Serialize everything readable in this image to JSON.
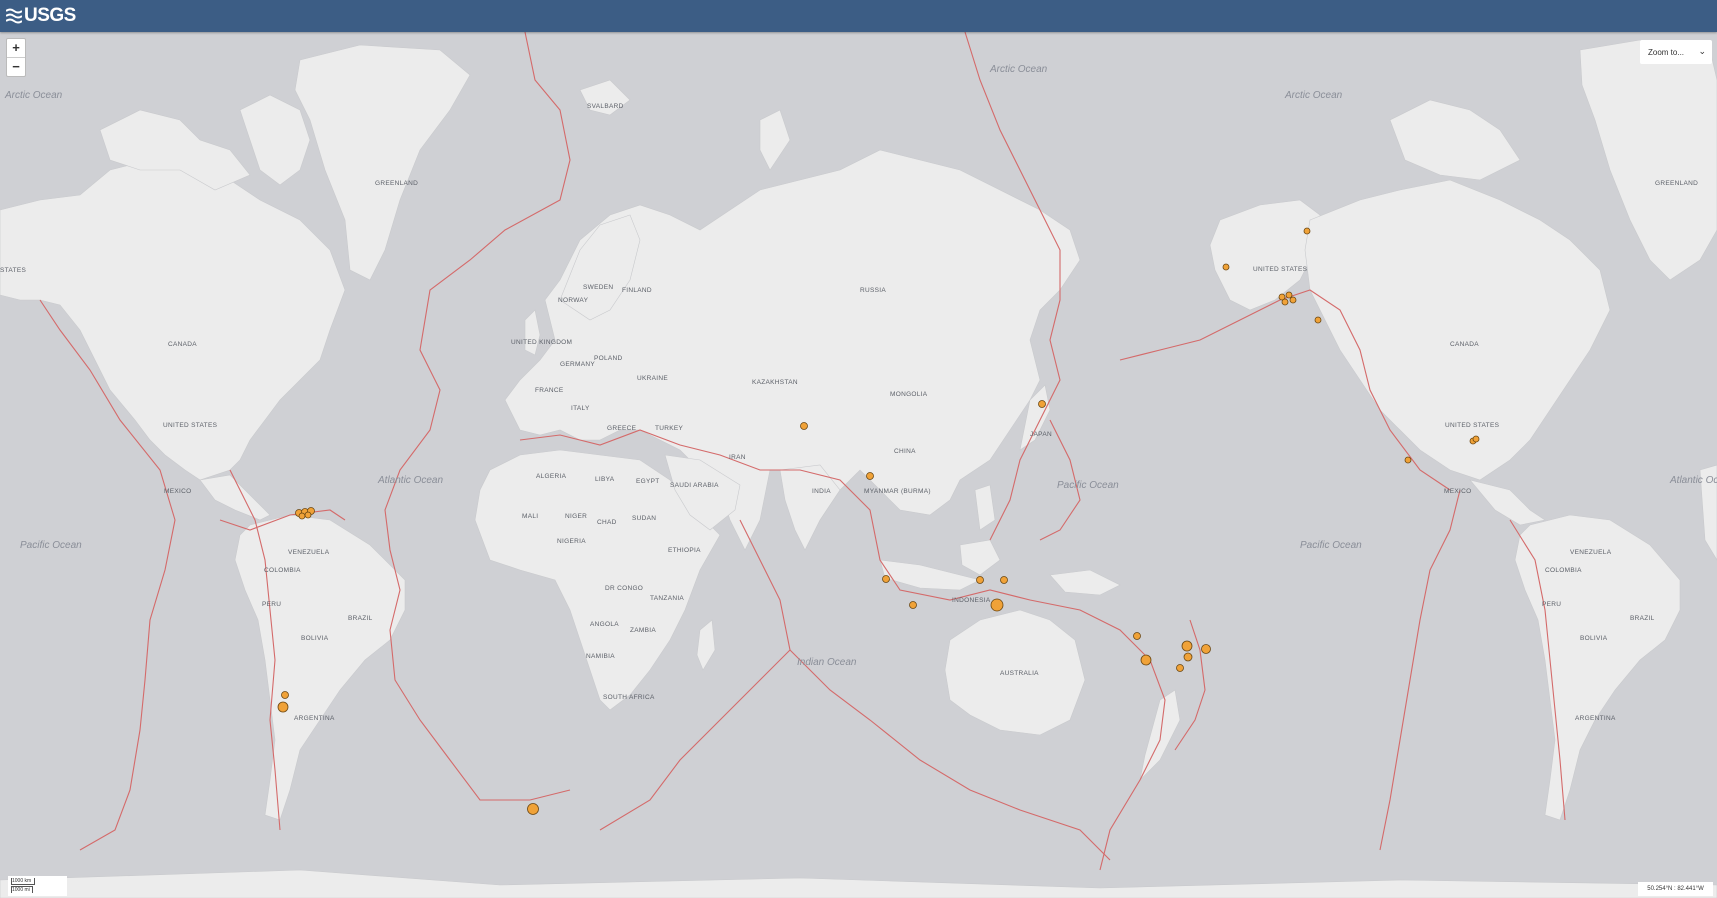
{
  "header": {
    "logo_text": "USGS"
  },
  "controls": {
    "zoom_in": "+",
    "zoom_out": "−",
    "zoom_to_label": "Zoom to..."
  },
  "scale": {
    "km": "1000 km",
    "mi": "1000 mi"
  },
  "coordinates": "50.254°N : 82.441°W",
  "colors": {
    "header": "#3c5d85",
    "water": "#cfd0d4",
    "land": "#ececec",
    "plate_boundary": "#d46a6a",
    "quake": "#f0a238"
  },
  "oceans": [
    "Arctic Ocean",
    "Arctic Ocean",
    "Arctic Ocean",
    "Atlantic Ocean",
    "Pacific Ocean",
    "Pacific Ocean",
    "Pacific Ocean",
    "Indian Ocean",
    "Atlantic Ocean"
  ],
  "countries": [
    "GREENLAND",
    "CANADA",
    "UNITED STATES",
    "MEXICO",
    "VENEZUELA",
    "COLOMBIA",
    "PERU",
    "BRAZIL",
    "BOLIVIA",
    "ARGENTINA",
    "SWEDEN",
    "FINLAND",
    "NORWAY",
    "UNITED KINGDOM",
    "GERMANY",
    "POLAND",
    "UKRAINE",
    "FRANCE",
    "ITALY",
    "GREECE",
    "TURKEY",
    "ALGERIA",
    "LIBYA",
    "EGYPT",
    "MALI",
    "NIGER",
    "CHAD",
    "SUDAN",
    "NIGERIA",
    "ETHIOPIA",
    "DR CONGO",
    "TANZANIA",
    "ANGOLA",
    "ZAMBIA",
    "NAMIBIA",
    "SOUTH AFRICA",
    "SAUDI ARABIA",
    "IRAN",
    "KAZAKHSTAN",
    "RUSSIA",
    "MONGOLIA",
    "CHINA",
    "INDIA",
    "MYANMAR (BURMA)",
    "JAPAN",
    "INDONESIA",
    "AUSTRALIA",
    "SVALBARD",
    "UNITED STATES",
    "GREENLAND",
    "CANADA",
    "UNITED STATES",
    "MEXICO",
    "COLOMBIA",
    "VENEZUELA",
    "PERU",
    "BRAZIL",
    "BOLIVIA",
    "ARGENTINA",
    "STATES"
  ]
}
